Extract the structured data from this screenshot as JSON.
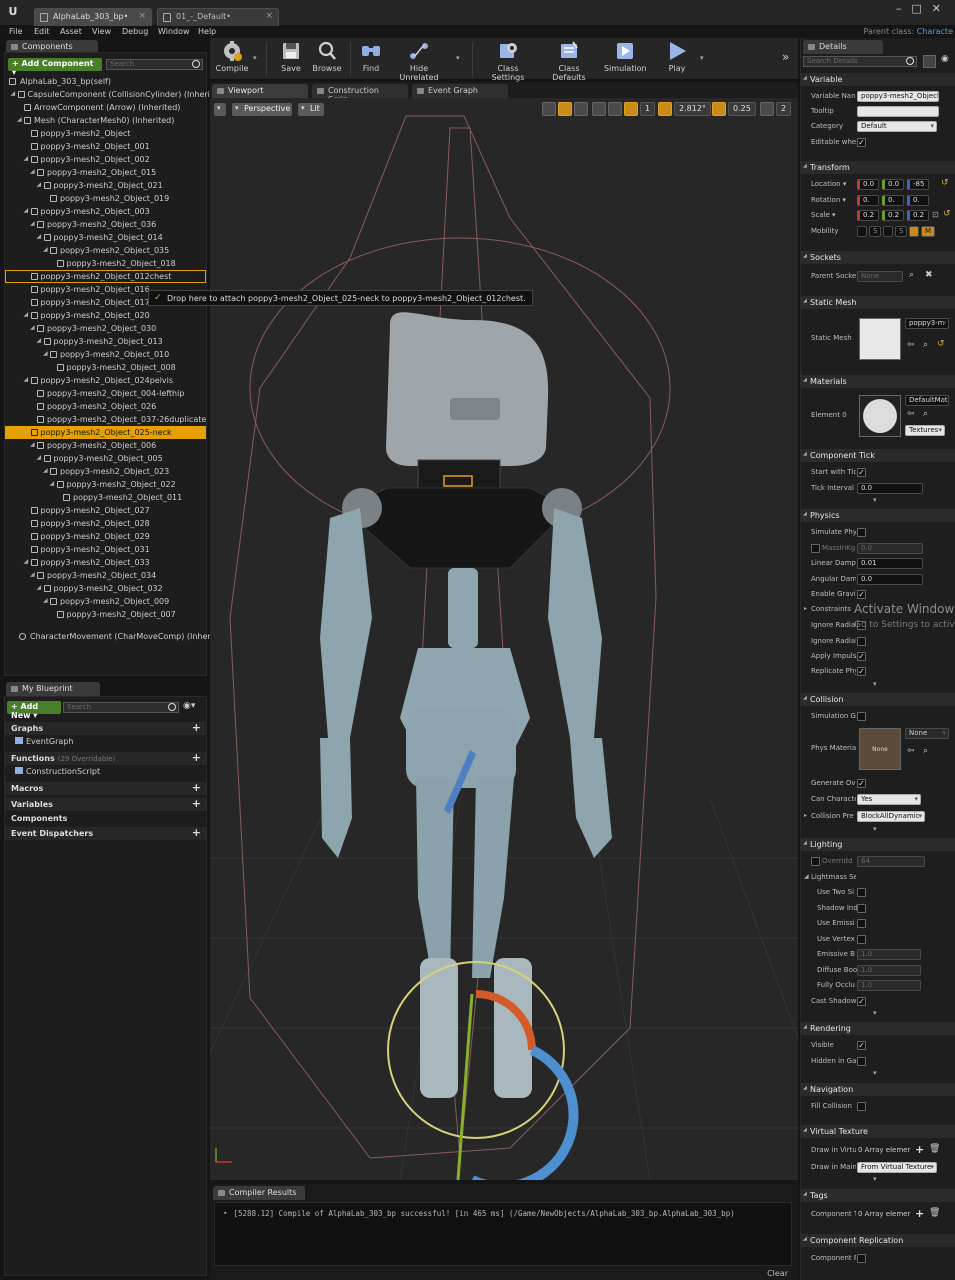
{
  "window": {
    "tabs": [
      {
        "label": "AlphaLab_303_bp•"
      },
      {
        "label": "01_-_Default•"
      }
    ],
    "parent_class_label": "Parent class:",
    "parent_class_value": "Characte"
  },
  "menu": [
    "File",
    "Edit",
    "Asset",
    "View",
    "Debug",
    "Window",
    "Help"
  ],
  "toolbar": {
    "compile": "Compile",
    "save": "Save",
    "browse": "Browse",
    "find": "Find",
    "hide_unrelated": "Hide Unrelated",
    "class_settings": "Class Settings",
    "class_defaults": "Class Defaults",
    "simulation": "Simulation",
    "play": "Play"
  },
  "components": {
    "tab_label": "Components",
    "add_button": "+ Add Component ▾",
    "search_placeholder": "Search",
    "self_label": "AlphaLab_303_bp(self)",
    "tree": [
      {
        "label": "CapsuleComponent (CollisionCylinder) (Inherited)",
        "depth": 1,
        "arrow": true
      },
      {
        "label": "ArrowComponent (Arrow) (Inherited)",
        "depth": 2,
        "arrow": false
      },
      {
        "label": "Mesh (CharacterMesh0) (Inherited)",
        "depth": 2,
        "arrow": true
      },
      {
        "label": "poppy3-mesh2_Object",
        "depth": 3,
        "arrow": false
      },
      {
        "label": "poppy3-mesh2_Object_001",
        "depth": 3,
        "arrow": false
      },
      {
        "label": "poppy3-mesh2_Object_002",
        "depth": 3,
        "arrow": true
      },
      {
        "label": "poppy3-mesh2_Object_015",
        "depth": 4,
        "arrow": true
      },
      {
        "label": "poppy3-mesh2_Object_021",
        "depth": 5,
        "arrow": true
      },
      {
        "label": "poppy3-mesh2_Object_019",
        "depth": 6,
        "arrow": false
      },
      {
        "label": "poppy3-mesh2_Object_003",
        "depth": 3,
        "arrow": true
      },
      {
        "label": "poppy3-mesh2_Object_036",
        "depth": 4,
        "arrow": true
      },
      {
        "label": "poppy3-mesh2_Object_014",
        "depth": 5,
        "arrow": true
      },
      {
        "label": "poppy3-mesh2_Object_035",
        "depth": 6,
        "arrow": true
      },
      {
        "label": "poppy3-mesh2_Object_018",
        "depth": 7,
        "arrow": false
      },
      {
        "label": "poppy3-mesh2_Object_012chest",
        "depth": 3,
        "arrow": false,
        "state": "drop-target"
      },
      {
        "label": "poppy3-mesh2_Object_016",
        "depth": 3,
        "arrow": false
      },
      {
        "label": "poppy3-mesh2_Object_017",
        "depth": 3,
        "arrow": false
      },
      {
        "label": "poppy3-mesh2_Object_020",
        "depth": 3,
        "arrow": true
      },
      {
        "label": "poppy3-mesh2_Object_030",
        "depth": 4,
        "arrow": true
      },
      {
        "label": "poppy3-mesh2_Object_013",
        "depth": 5,
        "arrow": true
      },
      {
        "label": "poppy3-mesh2_Object_010",
        "depth": 6,
        "arrow": true
      },
      {
        "label": "poppy3-mesh2_Object_008",
        "depth": 7,
        "arrow": false
      },
      {
        "label": "poppy3-mesh2_Object_024pelvis",
        "depth": 3,
        "arrow": true
      },
      {
        "label": "poppy3-mesh2_Object_004-lefthip",
        "depth": 4,
        "arrow": false
      },
      {
        "label": "poppy3-mesh2_Object_026",
        "depth": 4,
        "arrow": false
      },
      {
        "label": "poppy3-mesh2_Object_037-26duplicate",
        "depth": 4,
        "arrow": false
      },
      {
        "label": "poppy3-mesh2_Object_025-neck",
        "depth": 3,
        "arrow": true,
        "state": "selected"
      },
      {
        "label": "poppy3-mesh2_Object_006",
        "depth": 4,
        "arrow": true
      },
      {
        "label": "poppy3-mesh2_Object_005",
        "depth": 5,
        "arrow": true
      },
      {
        "label": "poppy3-mesh2_Object_023",
        "depth": 6,
        "arrow": true
      },
      {
        "label": "poppy3-mesh2_Object_022",
        "depth": 7,
        "arrow": true
      },
      {
        "label": "poppy3-mesh2_Object_011",
        "depth": 8,
        "arrow": false
      },
      {
        "label": "poppy3-mesh2_Object_027",
        "depth": 3,
        "arrow": false
      },
      {
        "label": "poppy3-mesh2_Object_028",
        "depth": 3,
        "arrow": false
      },
      {
        "label": "poppy3-mesh2_Object_029",
        "depth": 3,
        "arrow": false
      },
      {
        "label": "poppy3-mesh2_Object_031",
        "depth": 3,
        "arrow": false
      },
      {
        "label": "poppy3-mesh2_Object_033",
        "depth": 3,
        "arrow": true
      },
      {
        "label": "poppy3-mesh2_Object_034",
        "depth": 4,
        "arrow": true
      },
      {
        "label": "poppy3-mesh2_Object_032",
        "depth": 5,
        "arrow": true
      },
      {
        "label": "poppy3-mesh2_Object_009",
        "depth": 6,
        "arrow": true
      },
      {
        "label": "poppy3-mesh2_Object_007",
        "depth": 7,
        "arrow": false
      }
    ],
    "char_movement": "CharacterMovement (CharMoveComp) (Inherited)",
    "drop_tooltip": "Drop here to attach poppy3-mesh2_Object_025-neck to poppy3-mesh2_Object_012chest."
  },
  "my_blueprint": {
    "tab_label": "My Blueprint",
    "add_new": "+ Add New ▾",
    "search_placeholder": "Search",
    "graphs": "Graphs",
    "event_graph": "EventGraph",
    "functions": "Functions",
    "functions_sub": "(29 Overridable)",
    "construction_script": "ConstructionScript",
    "macros": "Macros",
    "variables": "Variables",
    "components": "Components",
    "event_dispatchers": "Event Dispatchers"
  },
  "viewport": {
    "tabs": [
      "Viewport",
      "Construction Scrip",
      "Event Graph"
    ],
    "perspective": "Perspective",
    "lit": "Lit",
    "grid_value": "1",
    "angle_value": "2.812°",
    "scale_value": "0.25",
    "camera_speed": "2"
  },
  "compiler": {
    "tab_label": "Compiler Results",
    "log": "[5288.12] Compile of AlphaLab_303_bp successful! [in 465 ms] (/Game/NewObjects/AlphaLab_303_bp.AlphaLab_303_bp)",
    "clear": "Clear"
  },
  "details": {
    "tab_label": "Details",
    "search_placeholder": "Search Details",
    "variable": {
      "title": "Variable",
      "name_label": "Variable Nan",
      "name_value": "poppy3-mesh2_Object_",
      "tooltip_label": "Tooltip",
      "category_label": "Category",
      "category_value": "Default",
      "editable_label": "Editable wher"
    },
    "transform": {
      "title": "Transform",
      "location_label": "Location ▾",
      "location": [
        "0.0",
        "0.0",
        "-85"
      ],
      "rotation_label": "Rotation ▾",
      "rotation": [
        "0.",
        "0.",
        "0."
      ],
      "scale_label": "Scale ▾",
      "scale": [
        "0.2",
        "0.2",
        "0.2"
      ],
      "mobility_label": "Mobility",
      "mobility_options": [
        "S",
        "S",
        "M"
      ]
    },
    "sockets": {
      "title": "Sockets",
      "parent_socket_label": "Parent Socke",
      "parent_socket_value": "None"
    },
    "static_mesh": {
      "title": "Static Mesh",
      "label": "Static Mesh",
      "value": "poppy3-m"
    },
    "materials": {
      "title": "Materials",
      "element_label": "Element 0",
      "value": "DefaultMat",
      "textures": "Textures"
    },
    "component_tick": {
      "title": "Component Tick",
      "start_label": "Start with Tic",
      "interval_label": "Tick Interval",
      "interval_value": "0.0"
    },
    "physics": {
      "title": "Physics",
      "simulate_label": "Simulate Phy",
      "mass_label": "MassInKg",
      "mass_value": "0.0",
      "linear_label": "Linear Dampi",
      "linear_value": "0.01",
      "angular_label": "Angular Dam",
      "angular_value": "0.0",
      "gravity_label": "Enable Gravit",
      "constraints_label": "Constraints",
      "ignore1_label": "Ignore Radial",
      "ignore2_label": "Ignore Radial",
      "impulse_label": "Apply Impuls",
      "replicate_label": "Replicate Phy"
    },
    "collision": {
      "title": "Collision",
      "sim_label": "Simulation G",
      "phys_mat_label": "Phys Materia",
      "phys_mat_thumb": "None",
      "phys_mat_value": "None",
      "generate_label": "Generate Ove",
      "can_char_label": "Can Characte",
      "can_char_value": "Yes",
      "preset_label": "Collision Pre",
      "preset_value": "BlockAllDynamic"
    },
    "lighting": {
      "title": "Lighting",
      "override_label": "Overridd",
      "override_value": "64",
      "lightmass_label": "Lightmass Se",
      "use_two_label": "Use Two Si",
      "shadow_ind_label": "Shadow Ind",
      "use_emissive_label": "Use Emissi",
      "use_vertex_label": "Use Vertex",
      "emissive_b_label": "Emissive B",
      "emissive_b_value": "1.0",
      "diffuse_label": "Diffuse Boo",
      "diffuse_value": "1.0",
      "fully_label": "Fully Occlu",
      "fully_value": "1.0",
      "cast_shadow_label": "Cast Shadow"
    },
    "rendering": {
      "title": "Rendering",
      "visible_label": "Visible",
      "hidden_label": "Hidden in Gar"
    },
    "navigation": {
      "title": "Navigation",
      "fill_label": "Fill Collision"
    },
    "virtual_texture": {
      "title": "Virtual Texture",
      "draw_virt_label": "Draw in Virtu",
      "draw_virt_value": "0 Array elemer",
      "draw_main_label": "Draw in Main",
      "draw_main_value": "From Virtual Texture"
    },
    "tags": {
      "title": "Tags",
      "comp_label": "Component T",
      "comp_value": "0 Array elemer"
    },
    "replication": {
      "title": "Component Replication",
      "label": "Component R"
    },
    "activate_windows": "Activate Windows",
    "activate_sub": "Go to Settings to activa"
  },
  "colors": {
    "selected": "#e6a000",
    "add_button": "#4a7f2a",
    "accent_blue": "#4fa3dc"
  }
}
